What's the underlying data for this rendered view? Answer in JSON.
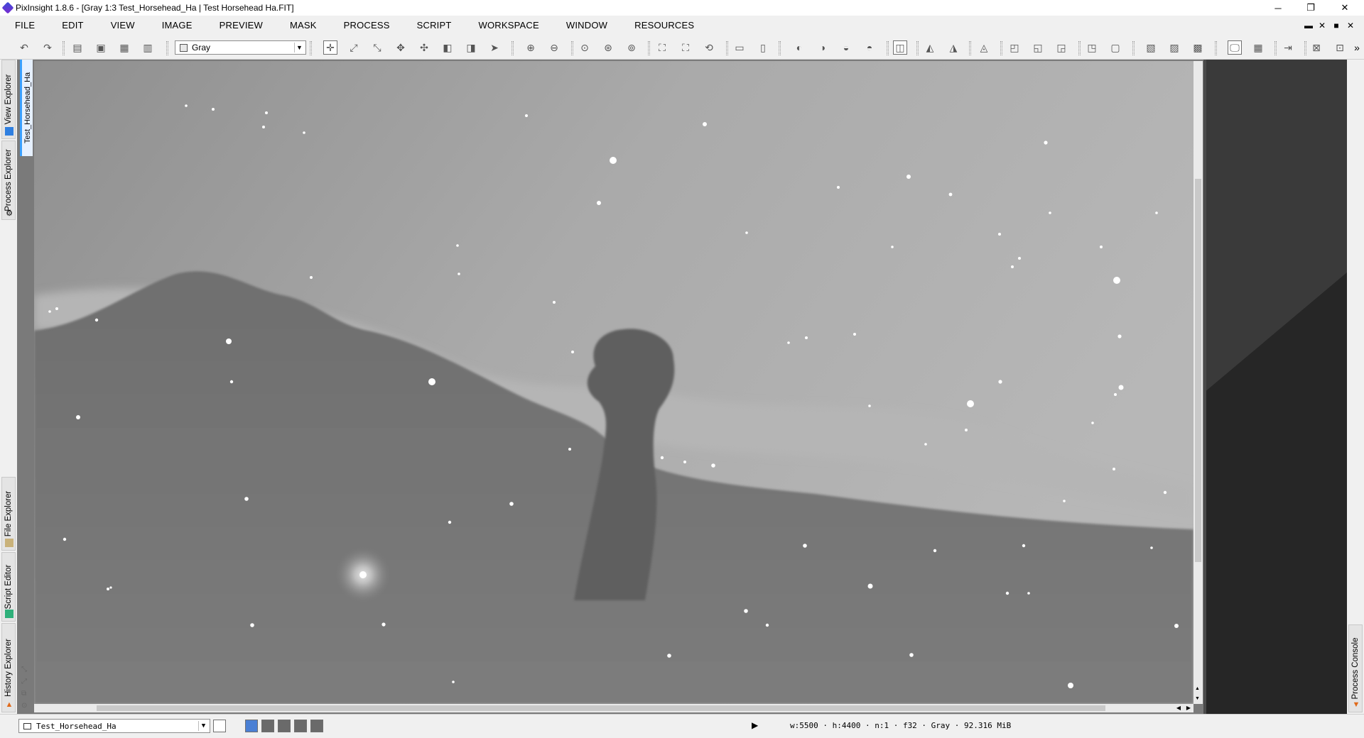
{
  "window": {
    "title": "PixInsight 1.8.6 - [Gray 1:3 Test_Horsehead_Ha | Test Horsehead Ha.FIT]",
    "minimize": "─",
    "maximize": "❐",
    "close": "✕"
  },
  "menu": [
    "FILE",
    "EDIT",
    "VIEW",
    "IMAGE",
    "PREVIEW",
    "MASK",
    "PROCESS",
    "SCRIPT",
    "WORKSPACE",
    "WINDOW",
    "RESOURCES"
  ],
  "mdi_controls": [
    "▬",
    "✕",
    "■",
    "✕"
  ],
  "toolbar": {
    "channel_select": "Gray",
    "overflow": "»"
  },
  "left_dock": {
    "tabs": [
      "View Explorer",
      "Process Explorer",
      "File Explorer",
      "Script Editor",
      "History Explorer"
    ]
  },
  "view_tab": "Test_Horsehead_Ha",
  "right_dock": {
    "tabs": [
      "Process Console"
    ]
  },
  "statusbar": {
    "view_select": "Test_Horsehead_Ha",
    "play": "▶",
    "info": "w:5500 · h:4400 · n:1 · f32 · Gray · 92.316 MiB"
  },
  "colors": {
    "accent": "#0078d7",
    "view_tab_marker": "#3aa0ff",
    "right_pane": "#2d2d2d"
  }
}
